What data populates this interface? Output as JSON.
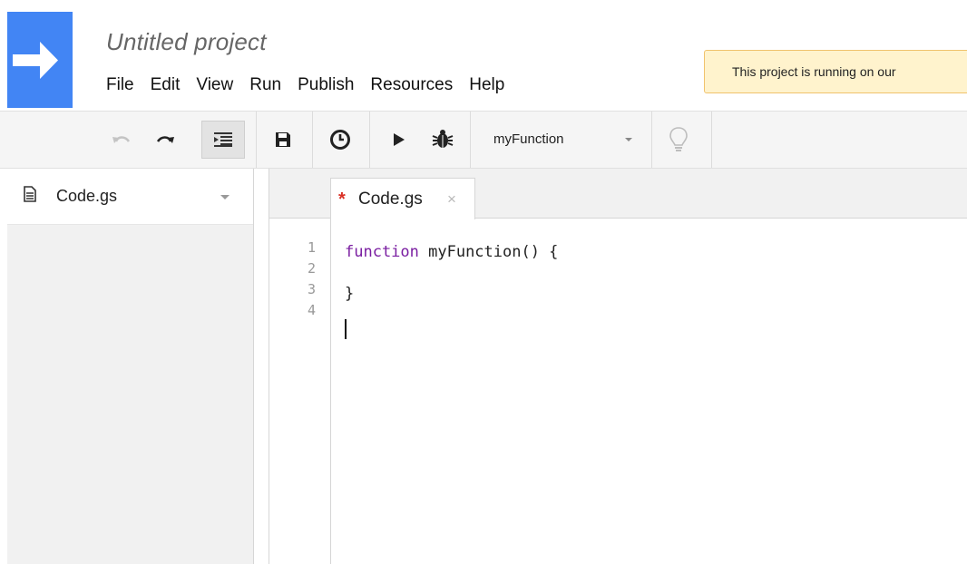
{
  "header": {
    "project_title": "Untitled project",
    "menu": [
      "File",
      "Edit",
      "View",
      "Run",
      "Publish",
      "Resources",
      "Help"
    ],
    "notice": "This project is running on our"
  },
  "toolbar": {
    "selected_function": "myFunction",
    "icons": [
      "undo-icon",
      "redo-icon",
      "indent-icon",
      "save-icon",
      "clock-icon",
      "run-icon",
      "debug-icon",
      "lightbulb-icon"
    ]
  },
  "sidebar": {
    "files": [
      {
        "name": "Code.gs"
      }
    ]
  },
  "editor": {
    "tab": {
      "dirty_marker": "*",
      "label": "Code.gs",
      "close": "×"
    },
    "line_numbers": [
      "1",
      "2",
      "3",
      "4"
    ],
    "lines": [
      {
        "keyword": "function",
        "rest": " myFunction() {"
      },
      {
        "keyword": "",
        "rest": ""
      },
      {
        "keyword": "",
        "rest": "}"
      },
      {
        "keyword": "",
        "rest": ""
      }
    ]
  },
  "colors": {
    "brand_blue": "#4285f4",
    "notice_bg": "#fff3cd",
    "keyword": "#7a1ea1",
    "dirty_marker": "#d93025"
  }
}
